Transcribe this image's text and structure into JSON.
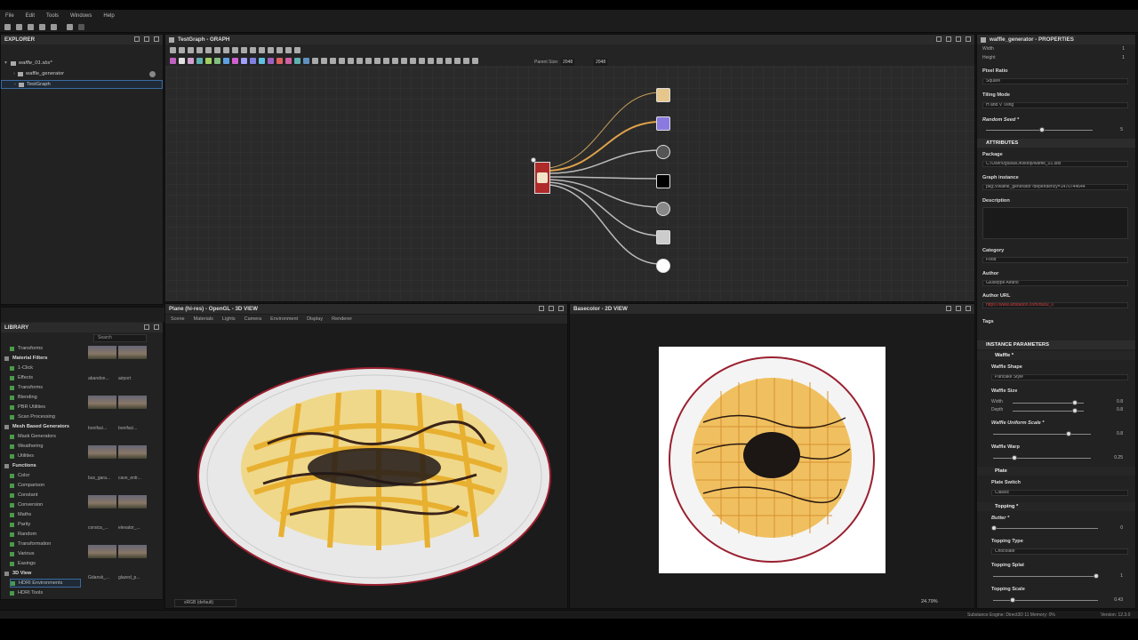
{
  "menu": [
    "File",
    "Edit",
    "Tools",
    "Windows",
    "Help"
  ],
  "explorer": {
    "title": "EXPLORER",
    "package": "waffle_01.sbs*",
    "items": [
      "waffle_generator",
      "TestGraph"
    ]
  },
  "graph": {
    "title": "TestGraph - GRAPH",
    "parent_size_label": "Parent Size:",
    "parent_size": "2048",
    "size2": "2048"
  },
  "library": {
    "title": "LIBRARY",
    "search": "Search",
    "items": [
      {
        "label": "Transforms",
        "cat": false
      },
      {
        "label": "Material Filters",
        "cat": true
      },
      {
        "label": "1-Click",
        "cat": false
      },
      {
        "label": "Effects",
        "cat": false
      },
      {
        "label": "Transforms",
        "cat": false
      },
      {
        "label": "Blending",
        "cat": false
      },
      {
        "label": "PBR Utilities",
        "cat": false
      },
      {
        "label": "Scan Processing",
        "cat": false
      },
      {
        "label": "Mesh Based Generators",
        "cat": true
      },
      {
        "label": "Mask Generators",
        "cat": false
      },
      {
        "label": "Weathering",
        "cat": false
      },
      {
        "label": "Utilities",
        "cat": false
      },
      {
        "label": "Functions",
        "cat": true
      },
      {
        "label": "Color",
        "cat": false
      },
      {
        "label": "Comparison",
        "cat": false
      },
      {
        "label": "Constant",
        "cat": false
      },
      {
        "label": "Conversion",
        "cat": false
      },
      {
        "label": "Maths",
        "cat": false
      },
      {
        "label": "Parity",
        "cat": false
      },
      {
        "label": "Random",
        "cat": false
      },
      {
        "label": "Transformation",
        "cat": false
      },
      {
        "label": "Various",
        "cat": false
      },
      {
        "label": "Easings",
        "cat": false
      },
      {
        "label": "3D View",
        "cat": true
      },
      {
        "label": "HDRI Environments",
        "cat": false
      },
      {
        "label": "HDRI Tools",
        "cat": false
      }
    ],
    "thumbs": [
      "abandon...",
      "airport",
      "bonifaci...",
      "bonifaci...",
      "bus_gara...",
      "cave_entr...",
      "corsica_...",
      "elevator_...",
      "Gdansk_...",
      "glazed_p..."
    ]
  },
  "view3d": {
    "title": "Plane (hi-res) - OpenGL - 3D VIEW",
    "menu": [
      "Scene",
      "Materials",
      "Lights",
      "Camera",
      "Environment",
      "Display",
      "Renderer"
    ],
    "colorspace": "sRGB (default)"
  },
  "view2d": {
    "title": "Basecolor - 2D VIEW",
    "zoom": "24.79%"
  },
  "properties": {
    "title": "waffle_generator - PROPERTIES",
    "width_label": "Width",
    "height_label": "Height",
    "width_val": "1",
    "height_val": "1",
    "pixel_ratio_label": "Pixel Ratio",
    "pixel_ratio": "Square",
    "tiling_label": "Tiling Mode",
    "tiling": "H and V Tiling",
    "seed_label": "Random Seed *",
    "seed_val": "5",
    "attributes": "ATTRIBUTES",
    "package_label": "Package",
    "package": "C:/Users/giusa/Desktop/waffle_01.sbs",
    "graph_instance_label": "Graph instance",
    "graph_instance": "pkg:///waffle_generator?dependency=1470744644",
    "description_label": "Description",
    "category_label": "Category",
    "category": "Food",
    "author_label": "Author",
    "author": "Giuseppe Alfano",
    "author_url_label": "Author URL",
    "author_url": "https://www.artstation.com/bs80_0",
    "tags_label": "Tags",
    "instance_params": "INSTANCE PARAMETERS",
    "waffle_section": "Waffle *",
    "waffle_shape_label": "Waffle Shape",
    "waffle_shape": "Pancake Style",
    "waffle_size_label": "Waffle Size",
    "width_sub": "Width",
    "depth_sub": "Depth",
    "size_w": "0.8",
    "size_d": "0.8",
    "uniform_label": "Waffle Uniform Scale *",
    "uniform_val": "0.8",
    "warp_label": "Waffle Warp",
    "warp_val": "0.25",
    "plate_section": "Plate",
    "plate_switch_label": "Plate Switch",
    "plate_switch": "Classic",
    "topping_section": "Topping *",
    "butter_label": "Butter *",
    "butter_val": "0",
    "topping_type_label": "Topping Type",
    "topping_type": "Chocolate",
    "topping_splat_label": "Topping Splat",
    "topping_splat_val": "1",
    "topping_scale_label": "Topping Scale",
    "topping_scale_val": "0.43"
  },
  "status": {
    "engine": "Substance Engine: Direct3D 11  Memory: 0%",
    "version": "Version: 12.3.0"
  }
}
